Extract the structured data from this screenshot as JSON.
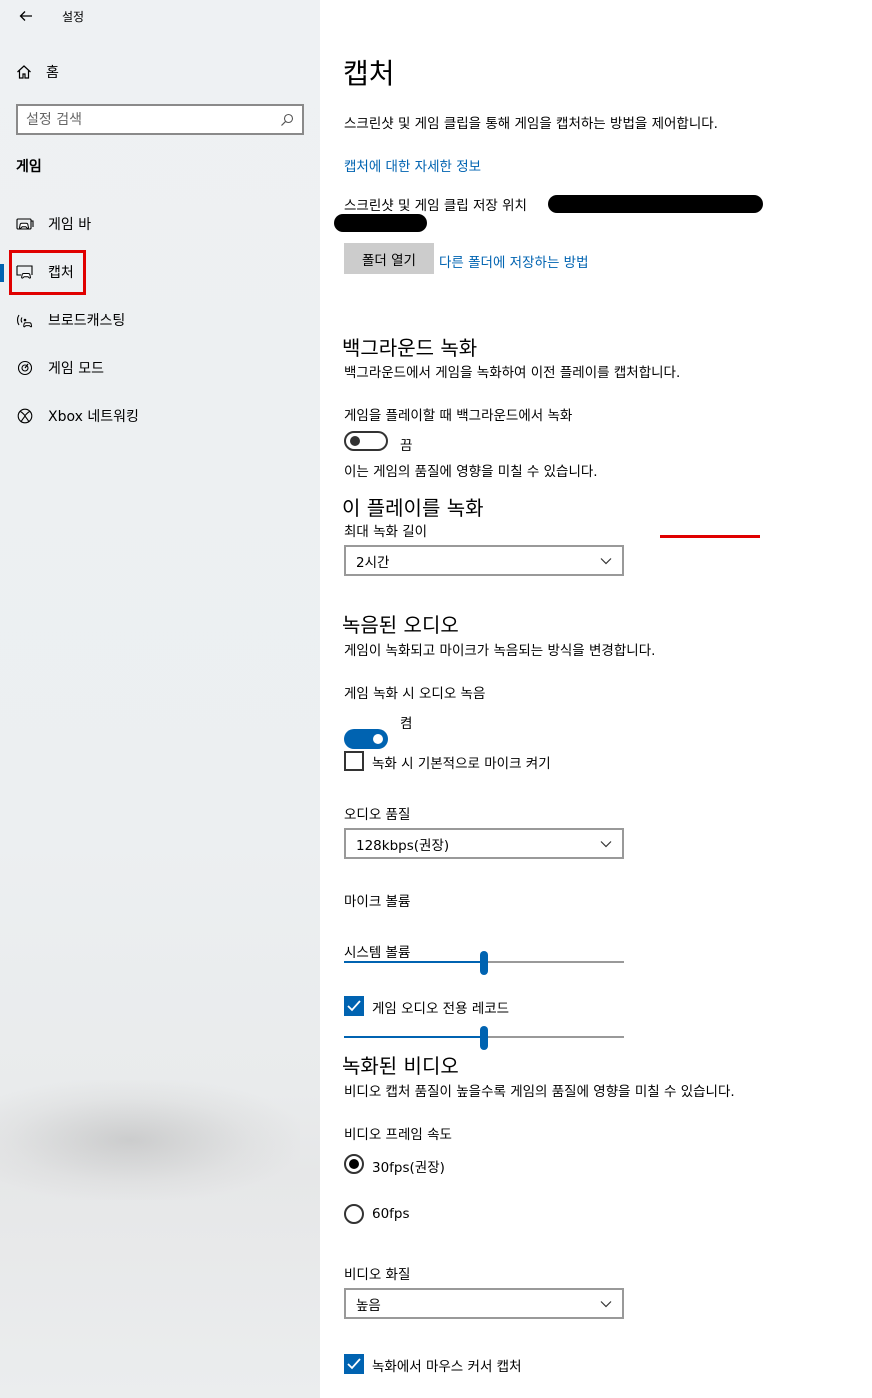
{
  "window": {
    "title": "설정"
  },
  "sidebar": {
    "home_label": "홈",
    "search_placeholder": "설정 검색",
    "section_title": "게임",
    "items": [
      {
        "label": "게임 바",
        "icon": "game-bar-icon"
      },
      {
        "label": "캡처",
        "icon": "capture-icon",
        "active": true
      },
      {
        "label": "브로드캐스팅",
        "icon": "broadcast-icon"
      },
      {
        "label": "게임 모드",
        "icon": "game-mode-icon"
      },
      {
        "label": "Xbox 네트워킹",
        "icon": "xbox-icon"
      }
    ]
  },
  "main": {
    "title": "캡처",
    "description": "스크린샷 및 게임 클립을 통해 게임을 캡처하는 방법을 제어합니다.",
    "more_info_link": "캡처에 대한 자세한 정보",
    "save_location_label": "스크린샷 및 게임 클립 저장 위치",
    "open_folder_button": "폴더 열기",
    "other_folder_link": "다른 폴더에 저장하는 방법",
    "background": {
      "heading": "백그라운드 녹화",
      "description": "백그라운드에서 게임을 녹화하여 이전 플레이를 캡처합니다.",
      "toggle_label": "게임을 플레이할 때 백그라운드에서 녹화",
      "toggle_state": "끔",
      "note": "이는 게임의 품질에 영향을 미칠 수 있습니다."
    },
    "record_this": {
      "heading": "이 플레이를 녹화",
      "max_length_label": "최대 녹화 길이",
      "max_length_value": "2시간"
    },
    "audio": {
      "heading": "녹음된 오디오",
      "description": "게임이 녹화되고 마이크가 녹음되는 방식을 변경합니다.",
      "record_audio_label": "게임 녹화 시 오디오 녹음",
      "record_audio_state": "켬",
      "mic_default_label": "녹화 시 기본적으로 마이크 켜기",
      "quality_label": "오디오 품질",
      "quality_value": "128kbps(권장)",
      "mic_volume_label": "마이크 볼륨",
      "mic_volume_value": 0.5,
      "system_volume_label": "시스템 볼륨",
      "system_volume_value": 0.5,
      "game_audio_only_label": "게임 오디오 전용 레코드"
    },
    "video": {
      "heading": "녹화된 비디오",
      "description": "비디오 캡처 품질이 높을수록 게임의 품질에 영향을 미칠 수 있습니다.",
      "framerate_label": "비디오 프레임 속도",
      "framerate_options": [
        "30fps(권장)",
        "60fps"
      ],
      "quality_label": "비디오 화질",
      "quality_value": "높음",
      "mouse_cursor_label": "녹화에서 마우스 커서 캡처"
    }
  },
  "colors": {
    "accent": "#0063b1",
    "highlight": "#e00000",
    "link": "#0063b1"
  }
}
